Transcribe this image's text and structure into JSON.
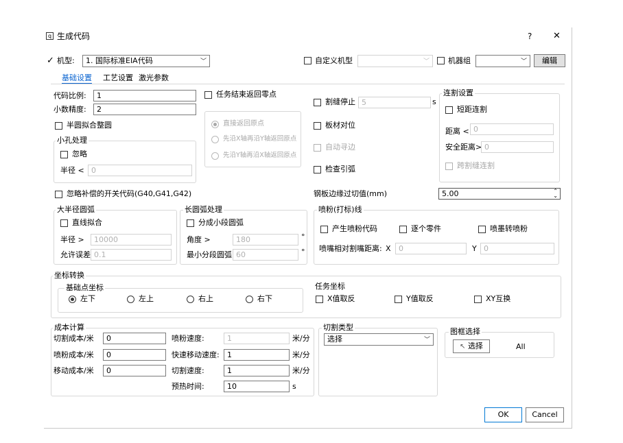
{
  "window": {
    "title": "生成代码",
    "help": "?",
    "close": "✕"
  },
  "top": {
    "machine_label": "机型:",
    "machine_value": "1. 国际标准EIA代码",
    "custom_machine_label": "自定义机型",
    "machine_group_label": "机器组",
    "edit_button": "编辑"
  },
  "tabs": [
    "基础设置",
    "工艺设置",
    "激光参数"
  ],
  "basic": {
    "code_ratio_label": "代码比例:",
    "code_ratio_value": "1",
    "decimals_label": "小数精度:",
    "decimals_value": "2",
    "semicircle_label": "半圆拟合整圆",
    "small_hole_group": "小孔处理",
    "ignore_label": "忽略",
    "radius_lt_label": "半径 <",
    "radius_lt_value": "0",
    "return_zero_label": "任务结束返回零点",
    "return_direct": "直接返回原点",
    "return_x_then_y": "先沿X轴再沿Y轴返回原点",
    "return_y_then_x": "先沿Y轴再沿X轴返回原点",
    "kerf_stop_label": "割缝停止",
    "kerf_stop_value": "5",
    "kerf_stop_unit": "s",
    "plate_align_label": "板材对位",
    "auto_edge_label": "自动寻边",
    "check_lead_label": "检查引弧",
    "connect_group": "连割设置",
    "short_connect_label": "短距连割",
    "distance_label": "距离 <",
    "distance_value": "0",
    "safe_distance_label": "安全距离>",
    "safe_distance_value": "0",
    "cross_kerf_label": "跨割缝连割",
    "ignore_comp_label": "忽略补偿的开关代码(G40,G41,G42)",
    "plate_edge_label": "钢板边缘过切值(mm)",
    "plate_edge_value": "5.00"
  },
  "large_arc": {
    "group": "大半径圆弧",
    "line_fit_label": "直线拟合",
    "radius_label": "半径 >",
    "radius_value": "10000",
    "tolerance_label": "允许误差",
    "tolerance_value": "0.1"
  },
  "long_arc": {
    "group": "长圆弧处理",
    "split_label": "分成小段圆弧",
    "angle_label": "角度 >",
    "angle_value": "180",
    "angle_unit": "°",
    "min_seg_label": "最小分段圆弧",
    "min_seg_value": "60",
    "min_seg_unit": "°"
  },
  "powder": {
    "group": "喷粉(打标)线",
    "gen_code_label": "产生喷粉代码",
    "per_part_label": "逐个零件",
    "ink_label": "喷墨转喷粉",
    "nozzle_label": "喷嘴相对割嘴距离:",
    "x_label": "X",
    "x_value": "0",
    "y_label": "Y",
    "y_value": "0"
  },
  "coord": {
    "group": "坐标转换",
    "base_group": "基础点坐标",
    "options": [
      "左下",
      "左上",
      "右上",
      "右下"
    ],
    "task_group": "任务坐标",
    "x_invert": "X值取反",
    "y_invert": "Y值取反",
    "xy_swap": "XY互换"
  },
  "cost": {
    "group": "成本计算",
    "cut_cost_label": "切割成本/米",
    "cut_cost_value": "0",
    "powder_cost_label": "喷粉成本/米",
    "powder_cost_value": "0",
    "move_cost_label": "移动成本/米",
    "move_cost_value": "0",
    "powder_speed_label": "喷粉速度:",
    "powder_speed_value": "1",
    "rapid_speed_label": "快速移动速度:",
    "rapid_speed_value": "1",
    "cut_speed_label": "切割速度:",
    "cut_speed_value": "1",
    "preheat_label": "预热时间:",
    "preheat_value": "10",
    "speed_unit": "米/分",
    "time_unit": "s"
  },
  "cut_type": {
    "group": "切割类型",
    "value": "选择"
  },
  "frame": {
    "group": "图框选择",
    "select_button": "选择",
    "all_label": "All"
  },
  "footer": {
    "ok": "OK",
    "cancel": "Cancel"
  },
  "colors": {
    "tab_active": "#0a64d0",
    "primary_border": "#0078d4"
  }
}
